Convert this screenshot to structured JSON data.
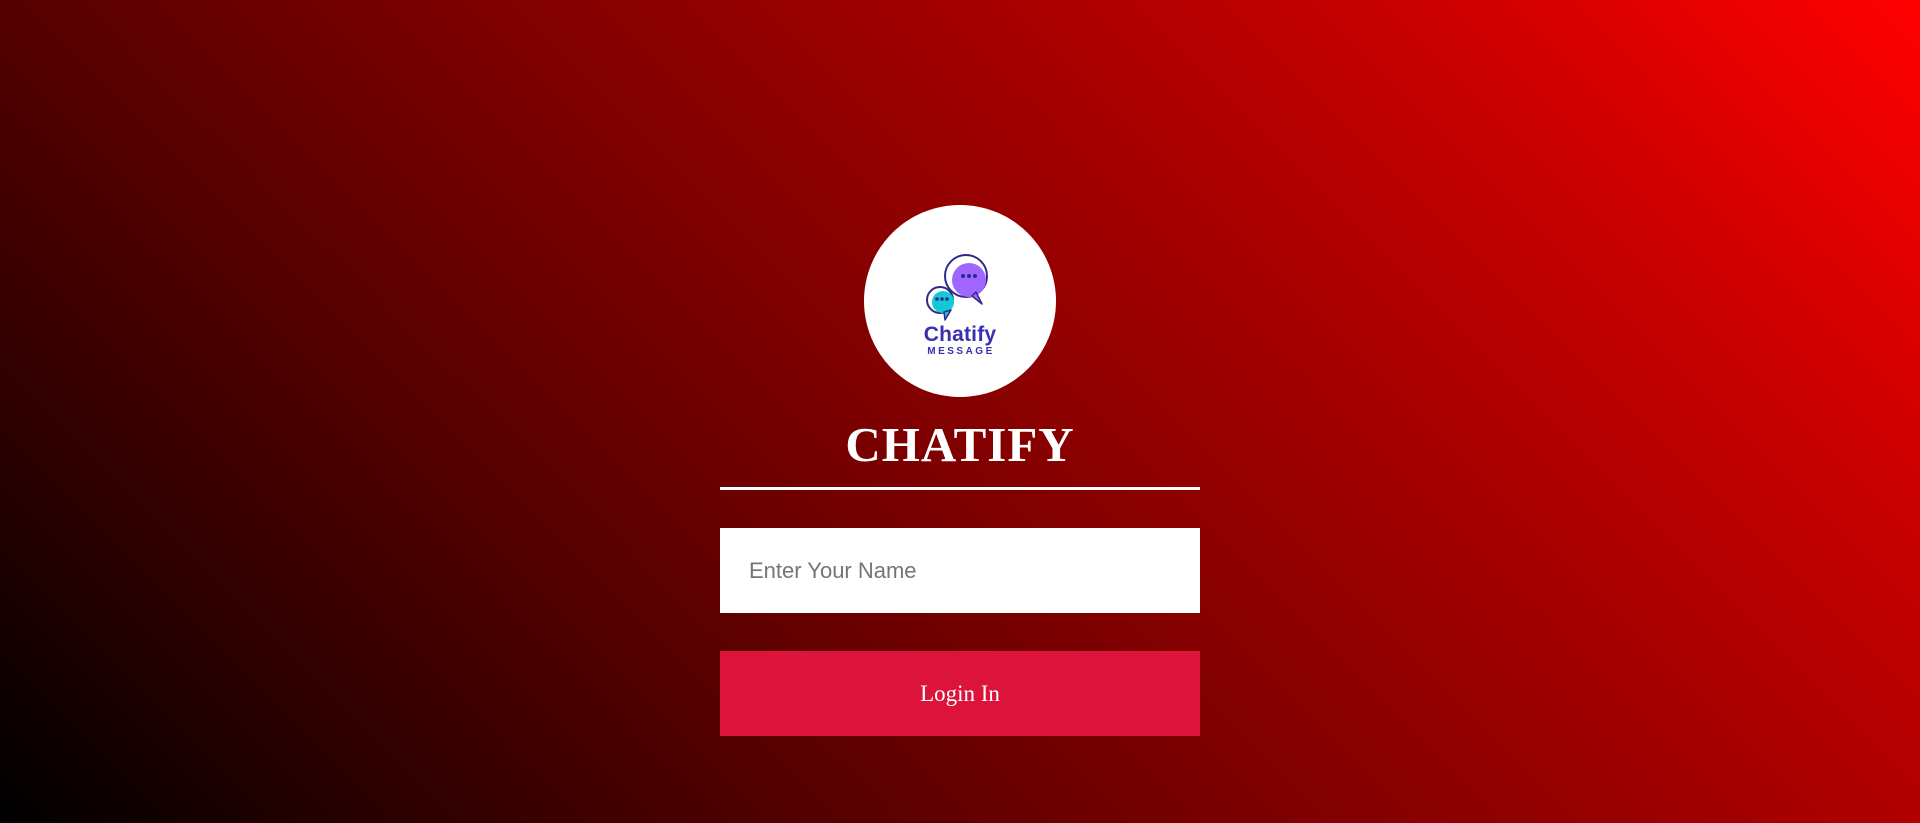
{
  "logo": {
    "icon": "chat-bubbles-icon",
    "wordmark": "Chatify",
    "subtext": "MESSAGE"
  },
  "title": "CHATIFY",
  "form": {
    "name_placeholder": "Enter Your Name",
    "name_value": "",
    "login_label": "Login In"
  },
  "colors": {
    "button": "#dc143c",
    "gradient_start": "#000000",
    "gradient_end": "#ff0000",
    "logo_text": "#3a2fb0",
    "bubble_purple": "#a066ff",
    "bubble_cyan": "#14c8d8"
  }
}
